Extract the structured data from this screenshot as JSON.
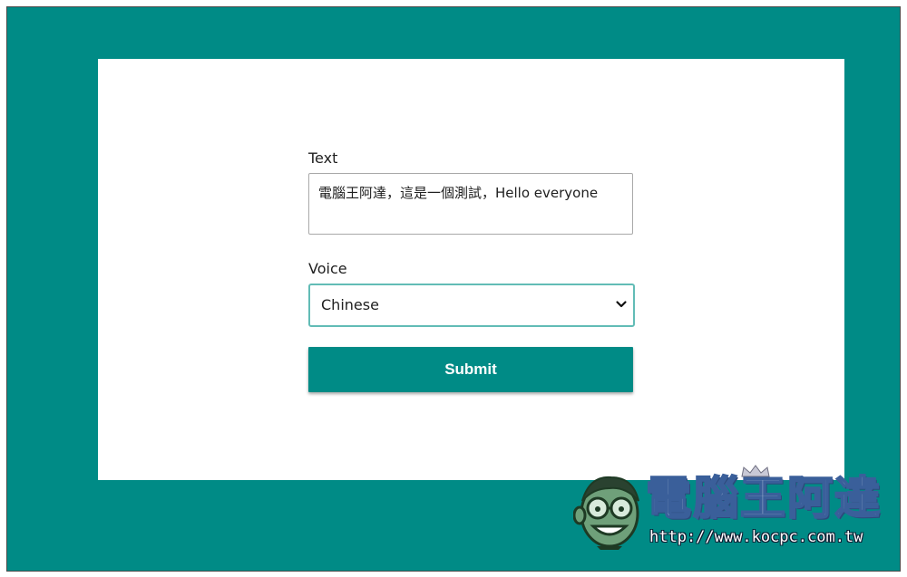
{
  "form": {
    "text_label": "Text",
    "text_value": "電腦王阿達，這是一個測試，Hello everyone",
    "voice_label": "Voice",
    "voice_selected": "Chinese",
    "submit_label": "Submit"
  },
  "watermark": {
    "brand": "電腦王阿達",
    "url": "http://www.kocpc.com.tw"
  },
  "colors": {
    "background": "#008b86",
    "accent": "#008b86",
    "select_border": "#62bcb6"
  },
  "icons": {
    "select_arrow": "chevron-down-icon",
    "mascot": "mascot-logo"
  }
}
